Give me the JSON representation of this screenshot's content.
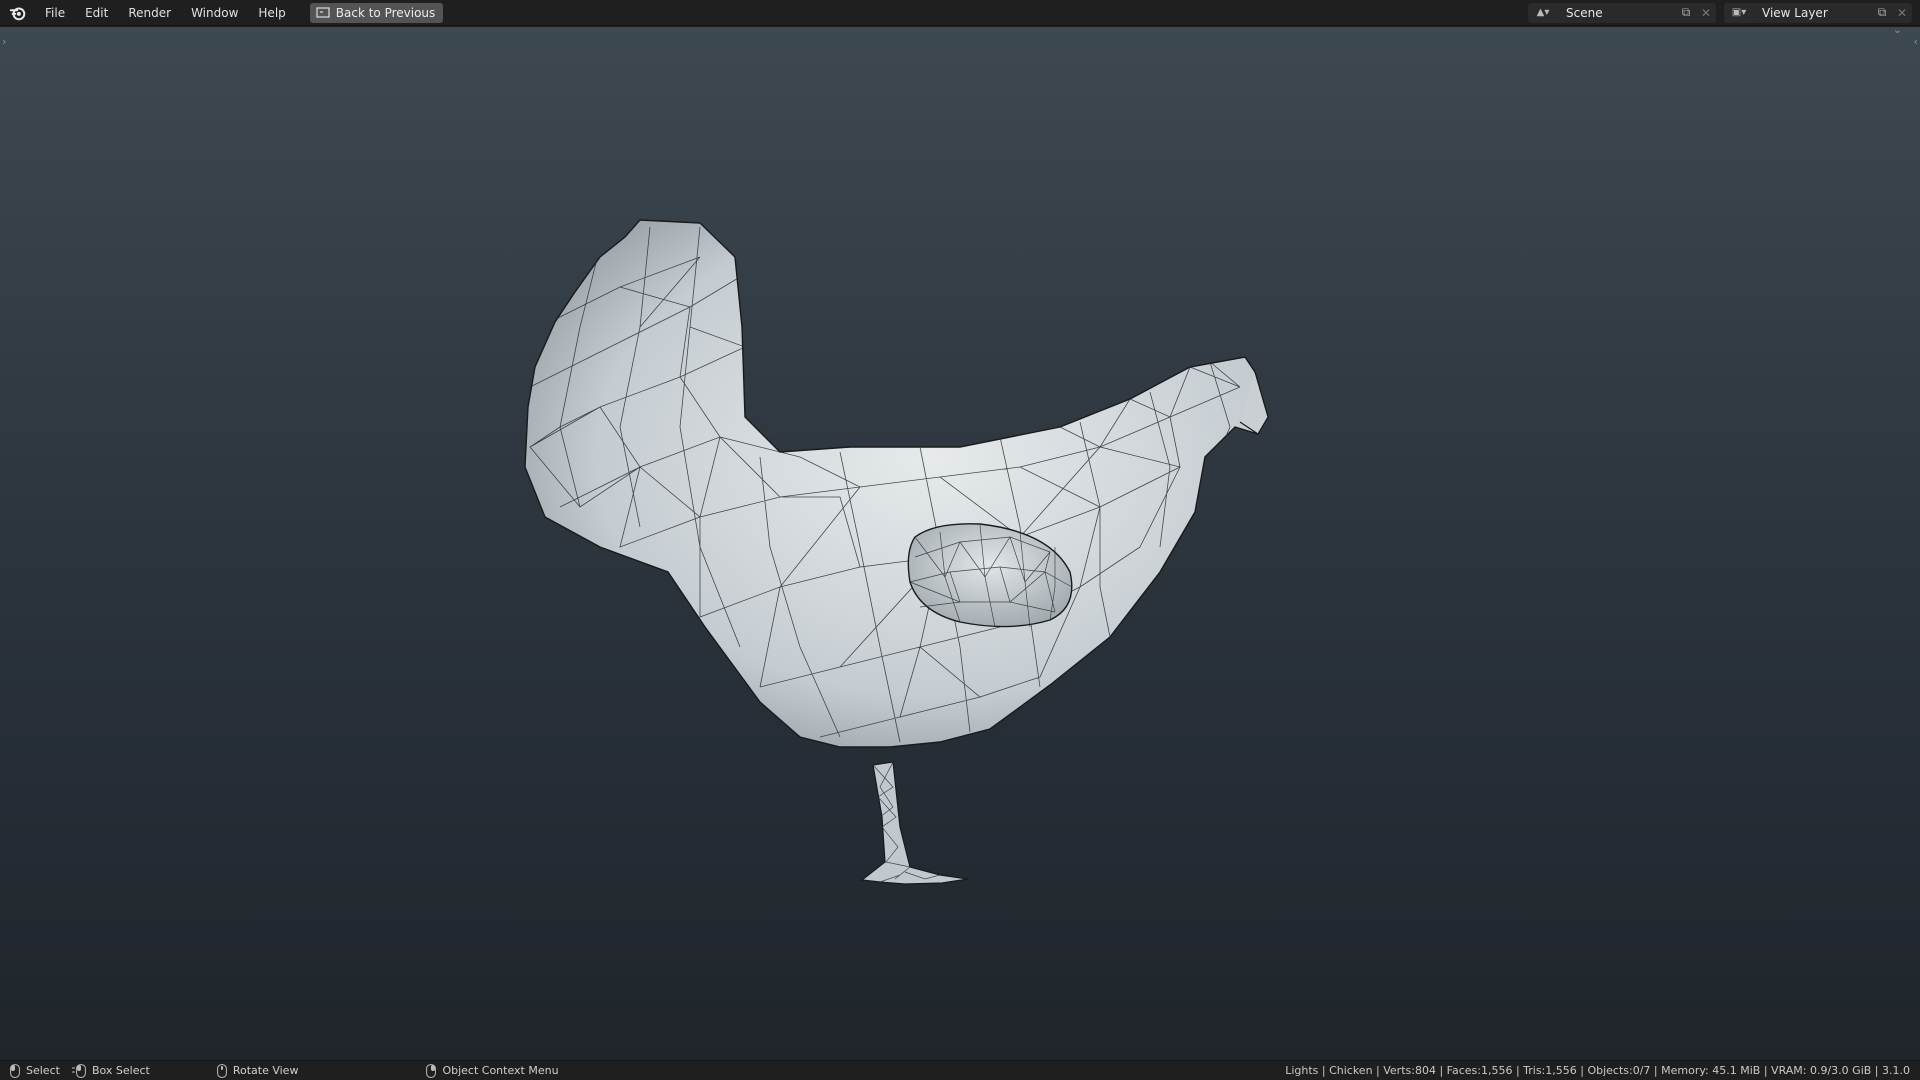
{
  "menu": [
    "File",
    "Edit",
    "Render",
    "Window",
    "Help"
  ],
  "back_button": {
    "label": "Back to Previous"
  },
  "scene_selector": {
    "value": "Scene",
    "icon": "scene-icon"
  },
  "view_layer_selector": {
    "value": "View Layer",
    "icon": "view-layer-icon"
  },
  "viewport": {
    "object": "Chicken",
    "mode": "wireframe-overlay"
  },
  "status": {
    "hints": [
      {
        "label": "Select",
        "icon": "mouse-left-icon"
      },
      {
        "label": "Box Select",
        "icon": "mouse-drag-icon"
      },
      {
        "label": "Rotate View",
        "icon": "mouse-middle-icon"
      },
      {
        "label": "Object Context Menu",
        "icon": "mouse-right-icon"
      }
    ],
    "stats": "Lights | Chicken | Verts:804 | Faces:1,556 | Tris:1,556 | Objects:0/7 | Memory: 45.1 MiB | VRAM: 0.9/3.0 GiB | 3.1.0"
  },
  "colors": {
    "background_top": "#3d4850",
    "background_bottom": "#1f252b",
    "mesh": "#c9cfd3",
    "wire": "#1a1a1a"
  }
}
